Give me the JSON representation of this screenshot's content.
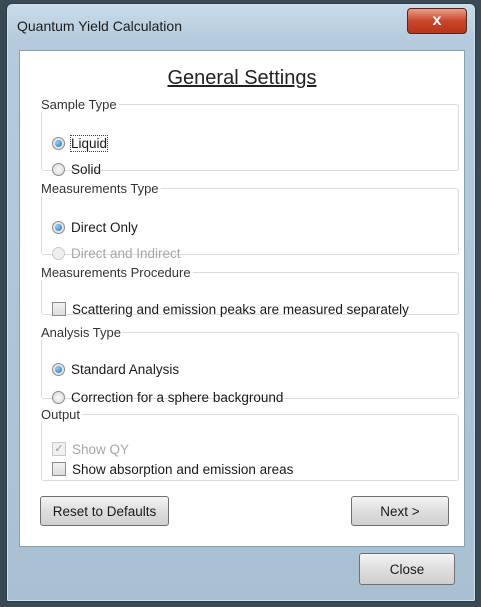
{
  "window": {
    "title": "Quantum Yield Calculation",
    "close_glyph": "x"
  },
  "heading": "General Settings",
  "groups": {
    "sample_type": {
      "legend": "Sample Type",
      "options": [
        "Liquid",
        "Solid"
      ],
      "selected": "Liquid"
    },
    "measurements_type": {
      "legend": "Measurements Type",
      "options": [
        "Direct Only",
        "Direct and Indirect"
      ],
      "selected": "Direct Only",
      "disabled": [
        "Direct and Indirect"
      ]
    },
    "measurements_procedure": {
      "legend": "Measurements Procedure",
      "checkbox_label": "Scattering and emission peaks are measured separately",
      "checked": false
    },
    "analysis_type": {
      "legend": "Analysis Type",
      "options": [
        "Standard Analysis",
        "Correction for a sphere background"
      ],
      "selected": "Standard Analysis"
    },
    "output": {
      "legend": "Output",
      "show_qy_label": "Show QY",
      "show_qy_checked": true,
      "show_qy_disabled": true,
      "show_areas_label": "Show absorption and emission areas",
      "show_areas_checked": false
    }
  },
  "buttons": {
    "reset": "Reset to Defaults",
    "next": "Next >",
    "close": "Close"
  }
}
